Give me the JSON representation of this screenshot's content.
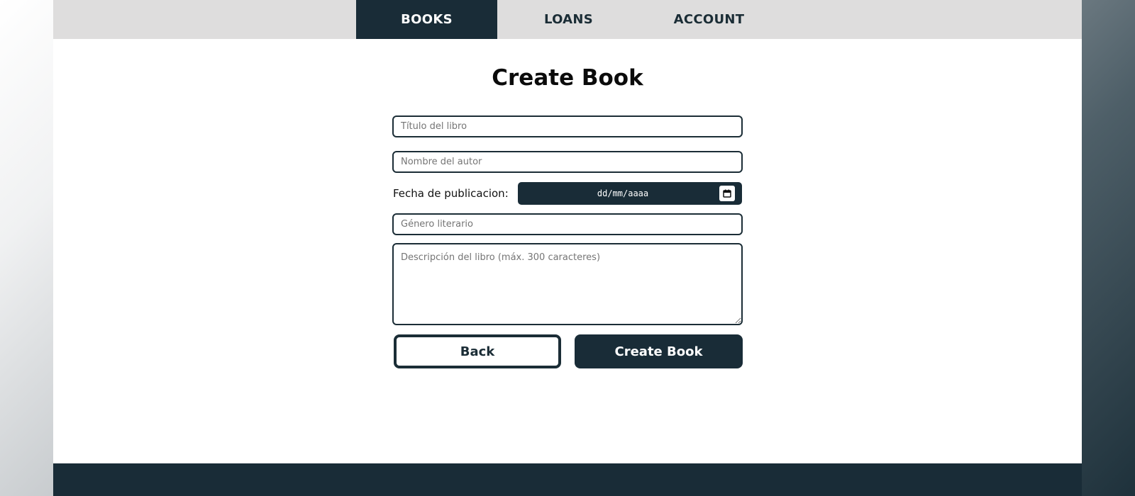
{
  "nav": {
    "tabs": [
      {
        "label": "BOOKS",
        "active": true
      },
      {
        "label": "LOANS",
        "active": false
      },
      {
        "label": "ACCOUNT",
        "active": false
      }
    ]
  },
  "form": {
    "title": "Create Book",
    "title_placeholder": "Título del libro",
    "author_placeholder": "Nombre del autor",
    "date_label": "Fecha de publicacion:",
    "date_value": "dd/mm/aaaa",
    "genre_placeholder": "Género literario",
    "description_placeholder": "Descripción del libro (máx. 300 caracteres)",
    "back_label": "Back",
    "submit_label": "Create Book"
  },
  "icons": {
    "calendar": "calendar-icon",
    "resize": "resize-handle-icon"
  },
  "colors": {
    "primary": "#192c37",
    "nav_background": "#dedddd",
    "page_background": "#ffffff"
  }
}
